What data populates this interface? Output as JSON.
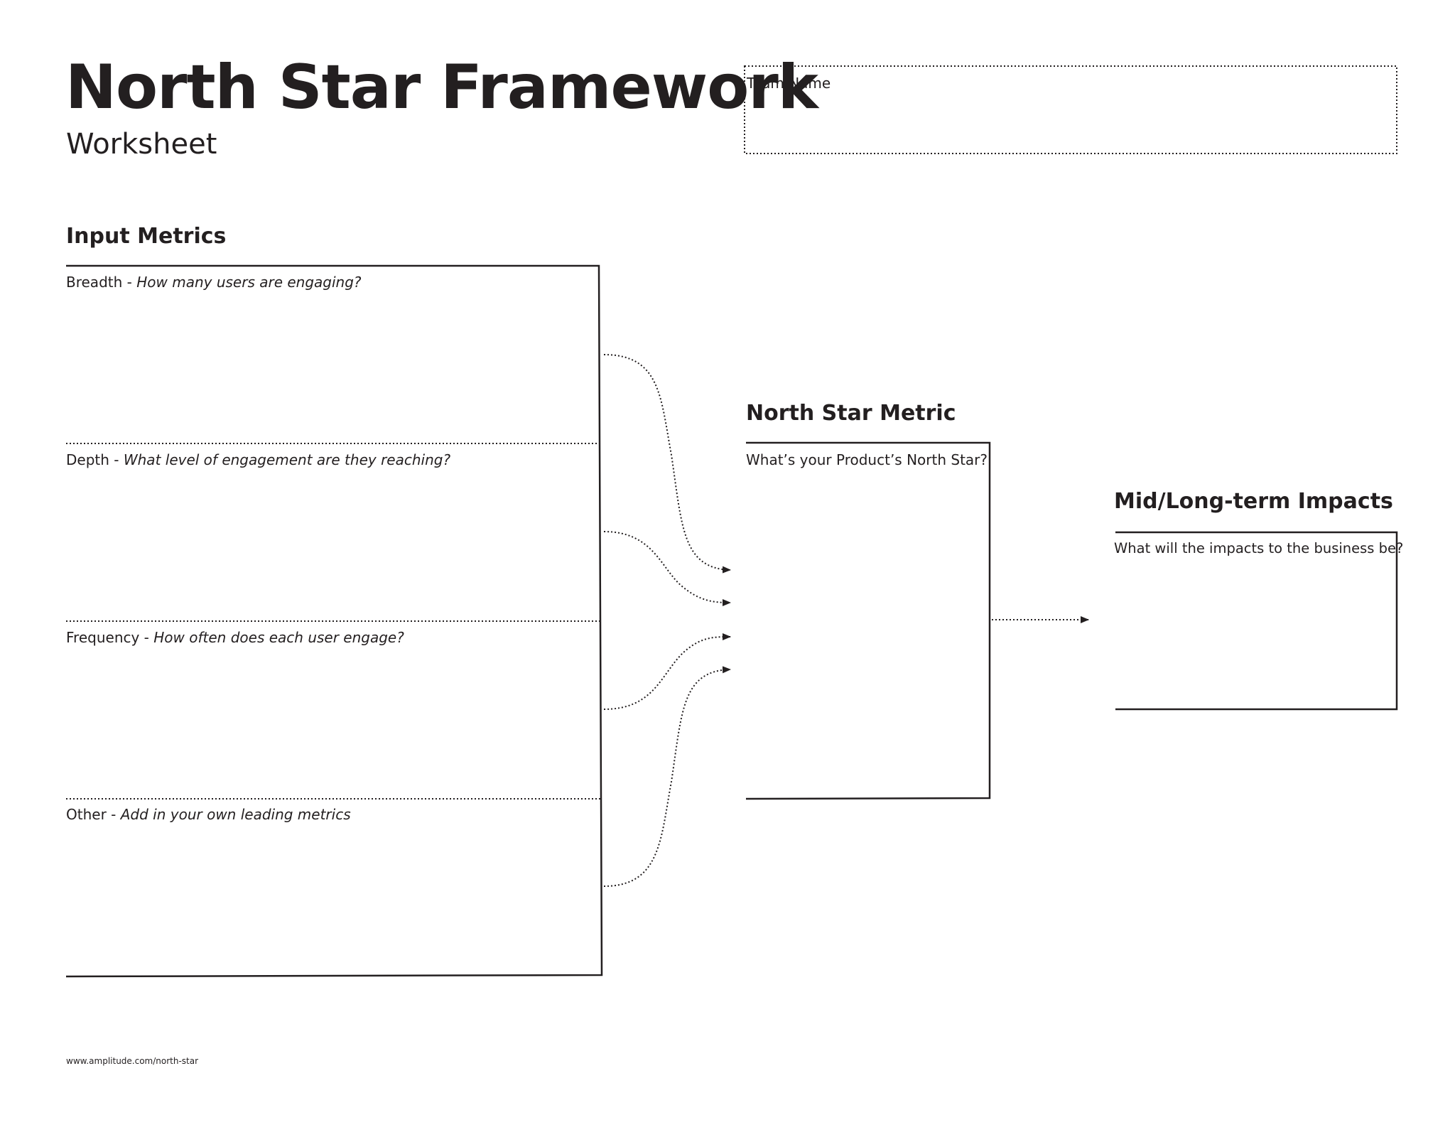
{
  "header": {
    "title": "North Star Framework",
    "subtitle": "Worksheet",
    "team_name_label": "Team Name"
  },
  "input_metrics": {
    "heading": "Input Metrics",
    "rows": [
      {
        "name": "Breadth",
        "separator": " - ",
        "prompt": "How many users are engaging?"
      },
      {
        "name": "Depth",
        "separator": " - ",
        "prompt": "What level of engagement are they reaching?"
      },
      {
        "name": "Frequency",
        "separator": " - ",
        "prompt": "How often does each user engage?"
      },
      {
        "name": "Other",
        "separator": " - ",
        "prompt": "Add in your own leading metrics"
      }
    ]
  },
  "north_star_metric": {
    "heading": "North Star Metric",
    "prompt": "What’s your Product’s North Star?"
  },
  "impacts": {
    "heading": "Mid/Long-term Impacts",
    "prompt": "What will the impacts to the business be?"
  },
  "footer": {
    "url": "www.amplitude.com/north-star"
  },
  "colors": {
    "ink": "#231f20",
    "background": "#ffffff"
  }
}
